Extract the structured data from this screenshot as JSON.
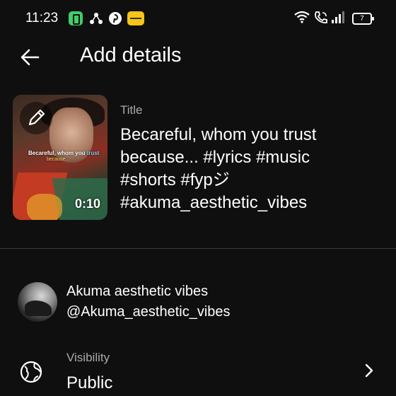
{
  "status_bar": {
    "time": "11:23",
    "battery_level": "7",
    "icons": [
      "green-app-icon",
      "tripod-app-icon",
      "pinterest-icon",
      "yellow-app-icon",
      "wifi-icon",
      "wifi-calling-icon",
      "signal-icon",
      "battery-icon"
    ]
  },
  "header": {
    "title": "Add details"
  },
  "video": {
    "overlay_text_part1": "Becareful, whom you ",
    "overlay_text_highlight": "trust",
    "overlay_text_line2": "because...",
    "duration": "0:10"
  },
  "title_field": {
    "label": "Title",
    "value_lines": [
      "Becareful, whom you trust",
      "because... #lyrics #music",
      "#shorts #fypジ",
      "#akuma_aesthetic_vibes"
    ]
  },
  "channel": {
    "name": "Akuma aesthetic vibes",
    "handle": "@Akuma_aesthetic_vibes"
  },
  "visibility": {
    "label": "Visibility",
    "value": "Public"
  },
  "colors": {
    "background": "#0f0f0f",
    "text_primary": "#ffffff",
    "text_secondary": "#aaaaaa",
    "divider": "#3a3a3a"
  }
}
